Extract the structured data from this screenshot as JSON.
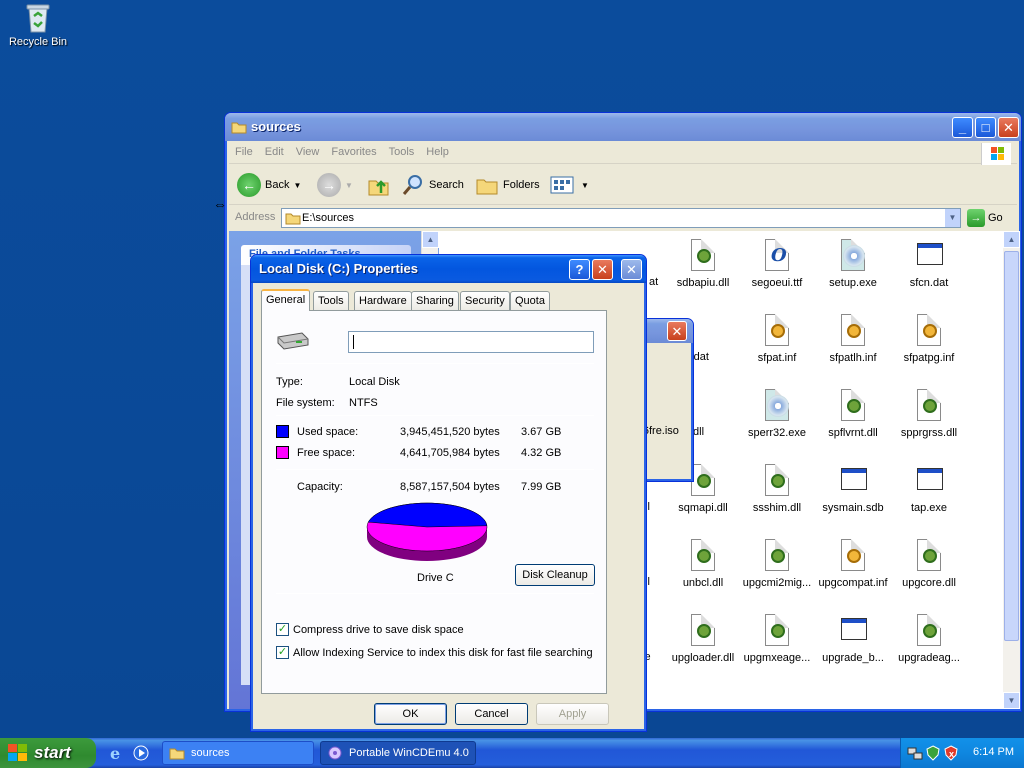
{
  "desktop": {
    "recycle_bin": "Recycle Bin"
  },
  "explorer": {
    "title": "sources",
    "menu": [
      "File",
      "Edit",
      "View",
      "Favorites",
      "Tools",
      "Help"
    ],
    "toolbar": {
      "back": "Back",
      "search": "Search",
      "folders": "Folders"
    },
    "address_label": "Address",
    "address_value": "E:\\sources",
    "go": "Go",
    "tasks_header": "File and Folder Tasks",
    "partial_labels": [
      "at",
      "xp.dat",
      "ipi.dll",
      "dll",
      "dll",
      "xe"
    ],
    "files": [
      {
        "name": "sdbapiu.dll",
        "icon": "dll-icon"
      },
      {
        "name": "segoeui.ttf",
        "icon": "font-icon"
      },
      {
        "name": "setup.exe",
        "icon": "setup-icon"
      },
      {
        "name": "sfcn.dat",
        "icon": "dat-icon"
      },
      {
        "name": "sfpat.inf",
        "icon": "inf-icon"
      },
      {
        "name": "sfpatlh.inf",
        "icon": "inf-icon"
      },
      {
        "name": "sfpatpg.inf",
        "icon": "inf-icon"
      },
      {
        "name": "sperr32.exe",
        "icon": "cd-icon"
      },
      {
        "name": "spflvrnt.dll",
        "icon": "dll-icon"
      },
      {
        "name": "spprgrss.dll",
        "icon": "dll-icon"
      },
      {
        "name": "sqmapi.dll",
        "icon": "dll-icon"
      },
      {
        "name": "ssshim.dll",
        "icon": "dll-icon"
      },
      {
        "name": "sysmain.sdb",
        "icon": "dat-icon"
      },
      {
        "name": "tap.exe",
        "icon": "exe-icon"
      },
      {
        "name": "unbcl.dll",
        "icon": "dll-icon"
      },
      {
        "name": "upgcmi2mig...",
        "icon": "dll-icon"
      },
      {
        "name": "upgcompat.inf",
        "icon": "inf-icon"
      },
      {
        "name": "upgcore.dll",
        "icon": "dll-icon"
      },
      {
        "name": "upgloader.dll",
        "icon": "dll-icon"
      },
      {
        "name": "upgmxeage...",
        "icon": "dll-icon"
      },
      {
        "name": "upgrade_b...",
        "icon": "dat-icon"
      },
      {
        "name": "upgradeag...",
        "icon": "dll-icon"
      }
    ]
  },
  "behind_dialog": {
    "iso_text": "L_x86fre.iso"
  },
  "properties": {
    "title": "Local Disk (C:) Properties",
    "tabs": [
      "General",
      "Tools",
      "Hardware",
      "Sharing",
      "Security",
      "Quota"
    ],
    "name_value": "",
    "type_label": "Type:",
    "type_value": "Local Disk",
    "fs_label": "File system:",
    "fs_value": "NTFS",
    "used_label": "Used space:",
    "used_bytes": "3,945,451,520 bytes",
    "used_gb": "3.67 GB",
    "free_label": "Free space:",
    "free_bytes": "4,641,705,984 bytes",
    "free_gb": "4.32 GB",
    "capacity_label": "Capacity:",
    "capacity_bytes": "8,587,157,504 bytes",
    "capacity_gb": "7.99 GB",
    "used_fraction": 0.4594,
    "drive_label": "Drive C",
    "disk_cleanup": "Disk Cleanup",
    "compress_label": "Compress drive to save disk space",
    "indexing_label": "Allow Indexing Service to index this disk for fast file searching",
    "ok": "OK",
    "cancel": "Cancel",
    "apply": "Apply",
    "colors": {
      "used": "#0000ff",
      "free": "#ff00ff"
    }
  },
  "taskbar": {
    "start": "start",
    "tasks": [
      "sources",
      "Portable WinCDEmu 4.0"
    ],
    "clock": "6:14 PM"
  }
}
